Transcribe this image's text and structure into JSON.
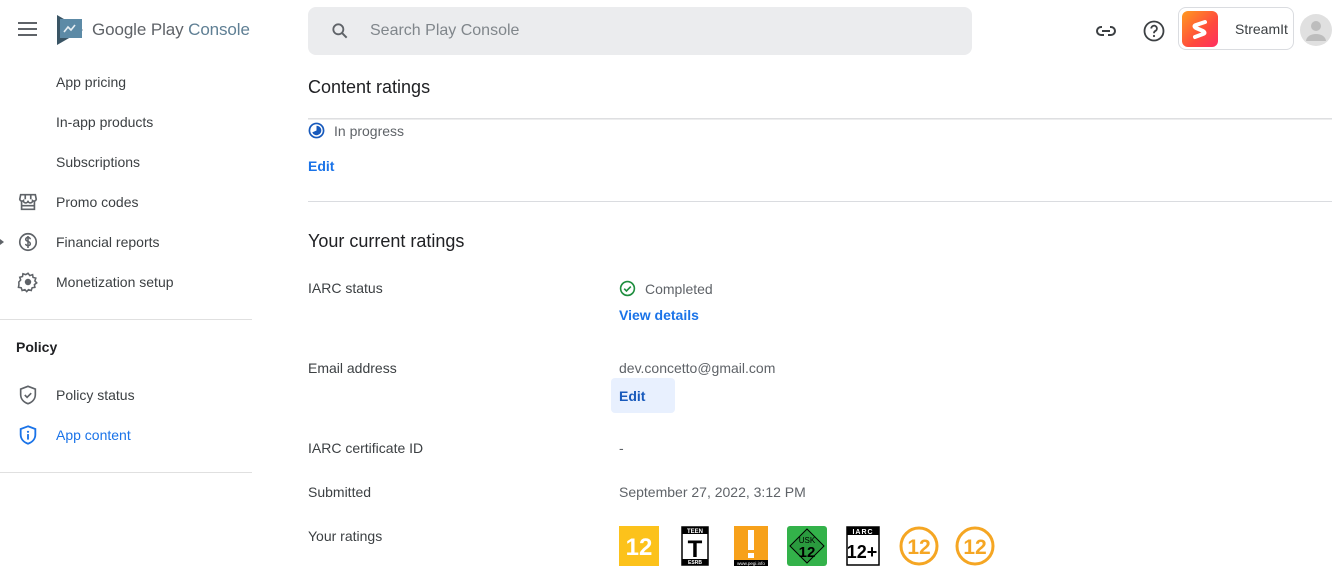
{
  "header": {
    "logo_brand": "Google Play",
    "logo_product": "Console",
    "search_placeholder": "Search Play Console",
    "app_name": "StreamIt",
    "icons": [
      "menu-icon",
      "link-icon",
      "help-icon",
      "account-avatar"
    ]
  },
  "sidebar": {
    "items": [
      {
        "label": "App pricing",
        "icon": null
      },
      {
        "label": "In-app products",
        "icon": null
      },
      {
        "label": "Subscriptions",
        "icon": null
      },
      {
        "label": "Promo codes",
        "icon": "storefront-icon"
      },
      {
        "label": "Financial reports",
        "icon": "dollar-circle-icon"
      },
      {
        "label": "Monetization setup",
        "icon": "gear-icon"
      }
    ],
    "policy_section": {
      "title": "Policy",
      "items": [
        {
          "label": "Policy status",
          "icon": "shield-check-icon",
          "active": false
        },
        {
          "label": "App content",
          "icon": "shield-info-icon",
          "active": true
        }
      ]
    }
  },
  "main": {
    "page_title": "Content ratings",
    "status": {
      "label": "In progress",
      "icon": "in-progress-icon"
    },
    "edit_label": "Edit",
    "current_ratings": {
      "title": "Your current ratings",
      "rows": {
        "iarc_status": {
          "label": "IARC status",
          "value": "Completed",
          "link": "View details"
        },
        "email": {
          "label": "Email address",
          "value": "dev.concetto@gmail.com",
          "button": "Edit"
        },
        "certificate": {
          "label": "IARC certificate ID",
          "value": "-"
        },
        "submitted": {
          "label": "Submitted",
          "value": "September 27, 2022, 3:12 PM"
        },
        "ratings": {
          "label": "Your ratings"
        }
      },
      "badges": [
        {
          "name": "classind-12",
          "text": "12",
          "color": "#fcc21b"
        },
        {
          "name": "esrb-teen",
          "text": "T",
          "top": "TEEN",
          "bottom": "ESRB"
        },
        {
          "name": "pegi-parental-guidance",
          "text": "!",
          "bottom": "www.pegi.info",
          "color": "#f7a11a"
        },
        {
          "name": "usk-12",
          "top": "USK",
          "text": "12",
          "color": "#33b24a"
        },
        {
          "name": "iarc-12plus",
          "top": "IARC",
          "text": "12+"
        },
        {
          "name": "generic-12-a",
          "text": "12",
          "color": "#f5a623"
        },
        {
          "name": "generic-12-b",
          "text": "12",
          "color": "#f5a623"
        }
      ]
    }
  },
  "colors": {
    "accent": "#1a73e8",
    "success": "#1e8e3e",
    "progress": "#185abc"
  }
}
